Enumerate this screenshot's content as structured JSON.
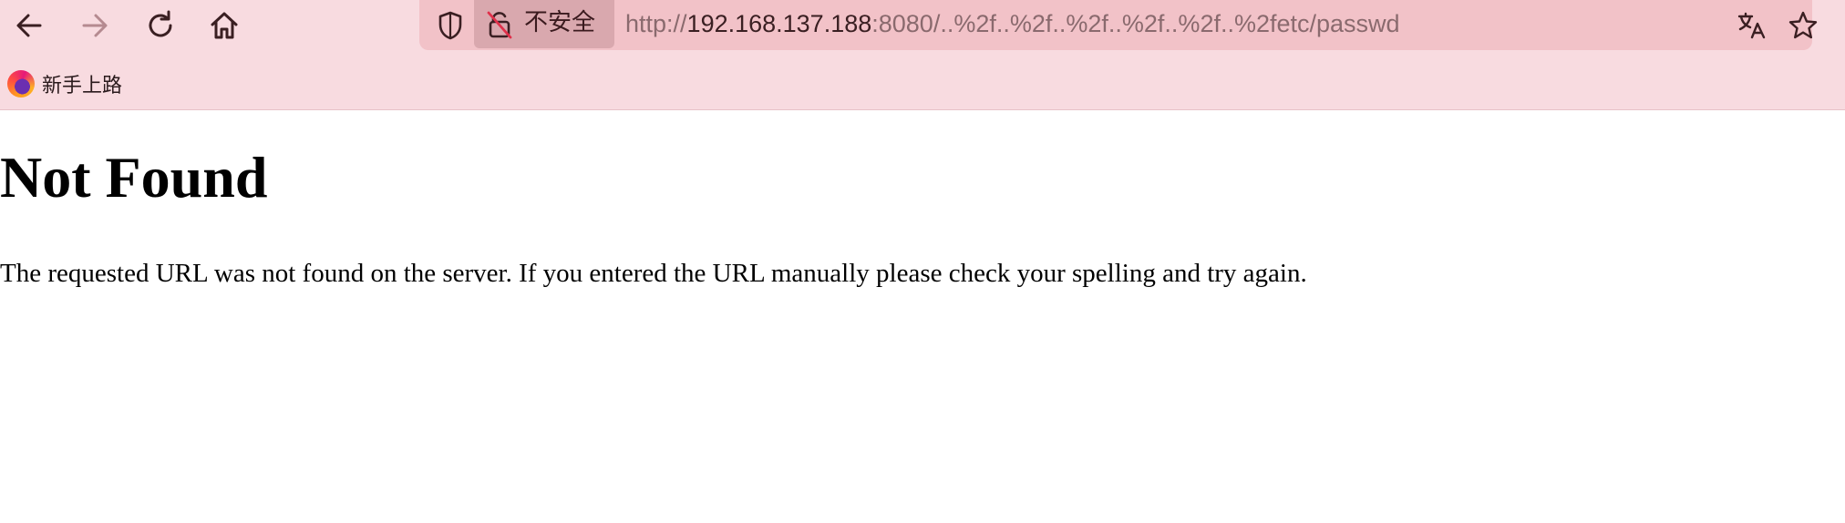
{
  "browser": {
    "toolbar": {
      "back_icon": "arrow-left-icon",
      "forward_icon": "arrow-right-icon",
      "reload_icon": "reload-icon",
      "home_icon": "home-icon"
    },
    "urlbar": {
      "security_label": "不安全",
      "url_scheme": "http://",
      "url_host": "192.168.137.188",
      "url_rest": ":8080/..%2f..%2f..%2f..%2f..%2f..%2fetc/passwd",
      "translate_icon": "translate-icon",
      "bookmark_icon": "star-icon"
    },
    "bookmarks_bar": {
      "items": [
        {
          "label": "新手上路",
          "icon": "firefox-icon"
        }
      ]
    },
    "colors": {
      "chrome_bg": "#f8dbe0",
      "urlbar_bg": "#f2c2c8",
      "security_chip_bg": "#d9a8ae"
    }
  },
  "page": {
    "heading": "Not Found",
    "message": "The requested URL was not found on the server. If you entered the URL manually please check your spelling and try again."
  }
}
